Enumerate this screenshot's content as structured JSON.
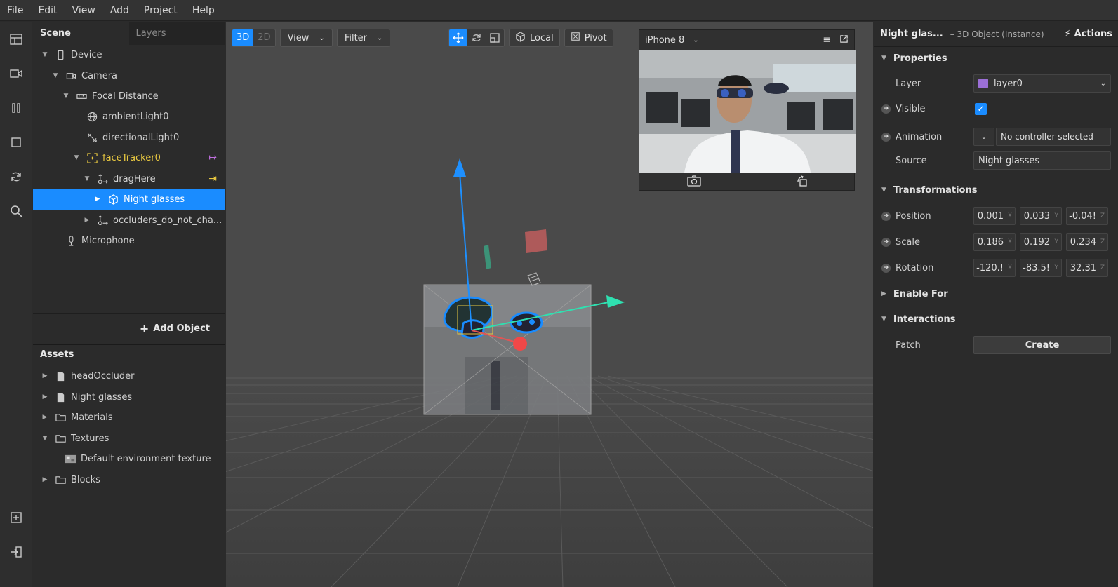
{
  "menu": [
    "File",
    "Edit",
    "View",
    "Add",
    "Project",
    "Help"
  ],
  "scene": {
    "tabs": [
      "Scene",
      "Layers"
    ],
    "tree": [
      {
        "label": "Device",
        "icon": "phone-icon",
        "arrow": "▼"
      },
      {
        "label": "Camera",
        "icon": "camera-icon",
        "arrow": "▼"
      },
      {
        "label": "Focal Distance",
        "icon": "focal-distance-icon",
        "arrow": "▼"
      },
      {
        "label": "ambientLight0",
        "icon": "globe-icon",
        "arrow": ""
      },
      {
        "label": "directionalLight0",
        "icon": "directional-light-icon",
        "arrow": ""
      },
      {
        "label": "faceTracker0",
        "icon": "face-tracker-icon",
        "arrow": "▼"
      },
      {
        "label": "dragHere",
        "icon": "null-object-icon",
        "arrow": "▼"
      },
      {
        "label": "Night glasses",
        "icon": "cube-icon",
        "arrow": "▶"
      },
      {
        "label": "occluders_do_not_cha...",
        "icon": "null-object-icon",
        "arrow": "▶"
      },
      {
        "label": "Microphone",
        "icon": "microphone-icon",
        "arrow": ""
      }
    ],
    "add_object": "Add Object"
  },
  "assets": {
    "title": "Assets",
    "items": [
      {
        "label": "headOccluder",
        "icon": "file-icon",
        "arrow": "▶"
      },
      {
        "label": "Night glasses",
        "icon": "file-icon",
        "arrow": "▶"
      },
      {
        "label": "Materials",
        "icon": "folder-icon",
        "arrow": "▶"
      },
      {
        "label": "Textures",
        "icon": "folder-icon",
        "arrow": "▼"
      },
      {
        "label": "Default environment texture",
        "icon": "texture-thumb-icon",
        "arrow": ""
      },
      {
        "label": "Blocks",
        "icon": "folder-icon",
        "arrow": "▶"
      }
    ]
  },
  "viewport": {
    "mode_3d": "3D",
    "mode_2d": "2D",
    "view": "View",
    "filter": "Filter",
    "local": "Local",
    "pivot": "Pivot"
  },
  "preview": {
    "device": "iPhone 8"
  },
  "inspector": {
    "title": "Night glas...",
    "subtitle": "– 3D Object (Instance)",
    "actions": "Actions",
    "sections": {
      "properties": "Properties",
      "transformations": "Transformations",
      "enable_for": "Enable For",
      "interactions": "Interactions"
    },
    "layer_label": "Layer",
    "layer_value": "layer0",
    "layer_color": "#9b6fd6",
    "visible_label": "Visible",
    "visible_checked": "✓",
    "animation_label": "Animation",
    "animation_value": "No controller selected",
    "source_label": "Source",
    "source_value": "Night glasses",
    "position_label": "Position",
    "position": [
      "0.001",
      "0.033",
      "-0.04!"
    ],
    "scale_label": "Scale",
    "scale": [
      "0.186",
      "0.192",
      "0.234"
    ],
    "rotation_label": "Rotation",
    "rotation": [
      "-120.!",
      "-83.5!",
      "32.31"
    ],
    "axes": [
      "X",
      "Y",
      "Z"
    ],
    "patch_label": "Patch",
    "create": "Create"
  },
  "colors": {
    "accent": "#1a8cff",
    "face_tracker": "#e8c840",
    "gizmo_y": "#1e90ff",
    "gizmo_x": "#2fe0b0"
  }
}
